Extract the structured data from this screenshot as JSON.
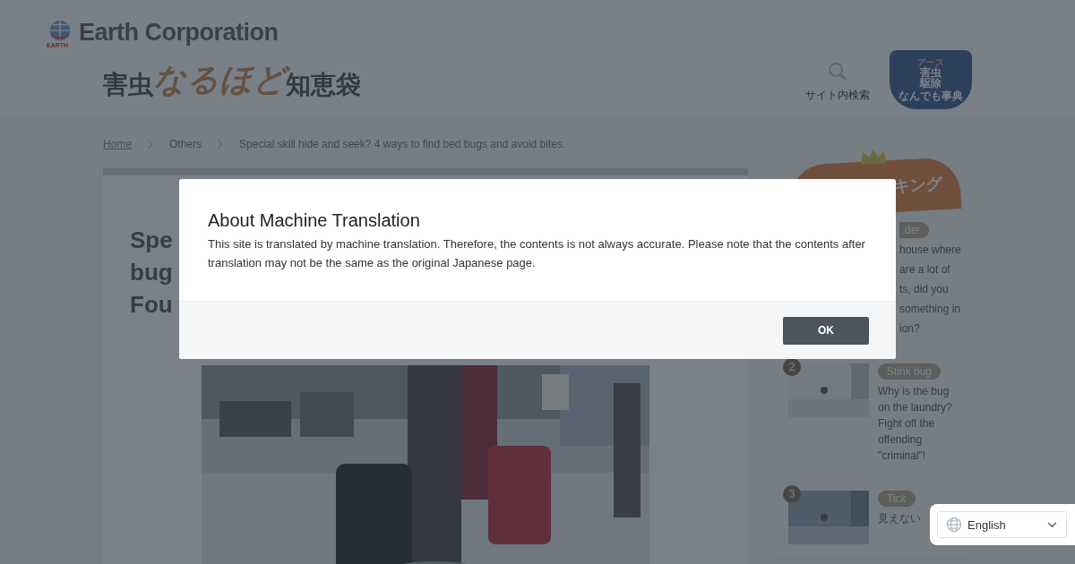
{
  "header": {
    "logo": {
      "mark_text": "EARTH",
      "name": "Earth Corporation"
    },
    "site_logo": [
      {
        "text": "害虫",
        "kind": "plain"
      },
      {
        "text": "なるほど",
        "kind": "accent"
      },
      {
        "text": "知恵袋",
        "kind": "plain"
      }
    ],
    "search": {
      "label": "サイト内検索"
    },
    "badge": {
      "lines": [
        "アース",
        "害虫",
        "駆除",
        "なんでも事典"
      ]
    }
  },
  "breadcrumb": [
    {
      "label": "Home",
      "kind": "link"
    },
    {
      "label": "Others",
      "kind": "text"
    },
    {
      "label": "Special skill hide and seek? 4 ways to find bed bugs and avoid bites.",
      "kind": "current"
    }
  ],
  "article": {
    "title_lines": [
      "Spe",
      "bug",
      "Fou"
    ]
  },
  "ranking": {
    "heading": "キング",
    "items": [
      {
        "kind": "partial",
        "tag": "der",
        "lines": [
          "house where",
          "are a lot of",
          "ts, did you",
          "something in",
          "ion?"
        ]
      },
      {
        "kind": "full",
        "rank": "2",
        "tag": "Stink bug",
        "text": "Why is the bug on the laundry? Fight off the offending \"criminal\"!"
      },
      {
        "kind": "full",
        "rank": "3",
        "tag": "Tick",
        "text": "見えない"
      }
    ]
  },
  "modal": {
    "title": "About Machine Translation",
    "text": "This site is translated by machine translation. Therefore, the contents is not always accurate. Please note that the contents after translation may not be the same as the original Japanese page.",
    "button": "OK"
  },
  "language": {
    "value": "English"
  }
}
